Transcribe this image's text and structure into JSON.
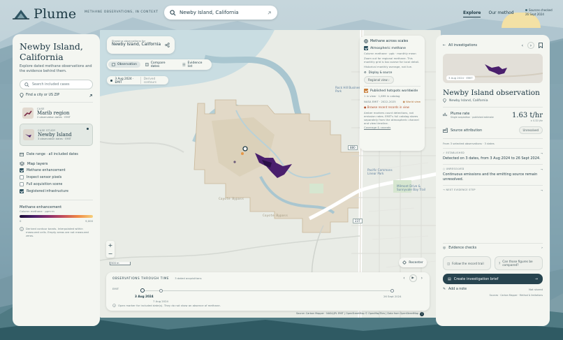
{
  "app": {
    "name": "Plume",
    "tagline": "METHANE OBSERVATIONS, IN CONTEXT"
  },
  "search": {
    "query": "Newby Island, California"
  },
  "nav": {
    "explore": "Explore",
    "method": "Our method",
    "sources_line1": "Sources checked",
    "sources_line2": "26 Sept 2024"
  },
  "left": {
    "title": "Newby Island, California",
    "subtitle": "Explore dated methane observations and the evidence behind them.",
    "search_placeholder": "Search included cases",
    "find_city": "Find a city or US ZIP",
    "cards": [
      {
        "kicker": "CASE",
        "title": "Marib region",
        "meta": "2 observation dates · EMIT"
      },
      {
        "kicker": "CASE STUDY",
        "title": "Newby Island",
        "meta": "3 observation dates · EMIT"
      }
    ],
    "date_range": "Date range · all included dates",
    "layers_title": "Map layers",
    "layers": [
      {
        "label": "Methane enhancement",
        "on": true
      },
      {
        "label": "Inspect sensor pixels",
        "on": false
      },
      {
        "label": "Full acquisition scene",
        "on": false
      },
      {
        "label": "Registered infrastructure",
        "on": true
      }
    ],
    "legend_title": "Methane enhancement",
    "legend_sub": "Column methane · ppm·m",
    "legend_min": "0",
    "legend_max": "9,000",
    "legend_note": "Derived contour bands. Interpolated within measured cells. Empty areas are not measured zeros."
  },
  "map": {
    "context_kicker": "Showing observations for",
    "context_title": "Newby Island, California",
    "tabs": [
      "Observation",
      "Compare dates",
      "Evidence list"
    ],
    "date_chip": "3 Aug 2024 · EMIT",
    "date_chip_mode": "Derived contours",
    "places": [
      "Coyote Bypass",
      "Coyote Bypass",
      "Rock Hill Business Park",
      "Pacific Commons Linear Park",
      "Milmont Drive & Sunnyvale Bay Trail",
      "Mission Center Rd & Cushing Pkwy"
    ],
    "roads": [
      "880",
      "237"
    ],
    "scale": "500 m",
    "recenter": "Recenter",
    "zoom_in": "+",
    "zoom_out": "−",
    "attribution": "Source: Carbon Mapper · NASA/JPL EMIT | OpenStreetMap © OpenMapTiles | Data from OpenStreetMap"
  },
  "scales": {
    "title": "Methane across scales",
    "atm_title": "Atmospheric methane",
    "atm_sub": "Column methane · ppb · monthly mean",
    "atm_note": "Zoom out for regional methane. This monthly grid is too coarse for local detail.",
    "atm_note2": "Historical monthly average, not live.",
    "display": "Display & source",
    "regional": "Regional view",
    "hot_title": "Published hotspots worldwide",
    "hot_sub": "1 in view · 1,699 in catalog",
    "hot_meta": "NASA EMIT · 2022–2025",
    "world": "World view",
    "browse": "Browse recent records in view",
    "hot_note": "Amber markers count detections, not emission rates. EMIT's full catalog stores separately from the atmospheric channel and view timeline.",
    "coverage": "Coverage & caveats"
  },
  "timeline": {
    "title": "OBSERVATIONS THROUGH TIME",
    "sub": "3 dated acquisitions",
    "axis": "EMIT",
    "dates": [
      "3 Aug 2024",
      "7 Aug 2024",
      "26 Sept 2024"
    ],
    "note": "Open marker for included date(s). They do not show an absence of methane."
  },
  "right": {
    "back": "All investigations",
    "thumb_label": "3 Aug 2024 · EMIT",
    "title": "Newby Island observation",
    "location": "Newby Island, California",
    "rate_label": "Plume rate",
    "rate_sub": "Single acquisition · published estimate",
    "rate_value": "1.63 t/hr",
    "rate_unc": "± 0.32 t/hr",
    "attrib_label": "Source attribution",
    "attrib_badge": "Unresolved",
    "from_line": "From 3 selected observations · 3 dates",
    "established_k": "ESTABLISHED",
    "established": "Detected on 3 dates, from 3 Aug 2024 to 26 Sept 2024.",
    "unresolved_k": "UNRESOLVED",
    "unresolved": "Continuous emissions and the emitting source remain unresolved.",
    "next_k": "NEXT EVIDENCE STEP",
    "evidence_checks": "Evidence checks",
    "follow": "Follow the record trail",
    "compare": "Can those figures be compared?",
    "create": "Create investigation brief",
    "add_note": "Add a note",
    "stored": "Not stored",
    "footer": "Sources · Carbon Mapper · Method & limitations"
  }
}
